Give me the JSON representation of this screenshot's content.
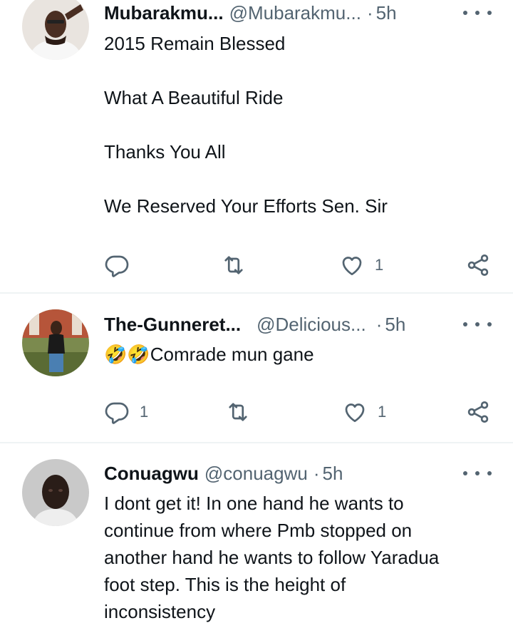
{
  "replies": [
    {
      "display_name": "Mubarakmu...",
      "handle": "@Mubarakmu...",
      "separator": "·",
      "time": "5h",
      "text_lines": [
        "2015 Remain Blessed",
        "What A Beautiful Ride",
        "Thanks You All",
        "We Reserved Your Efforts Sen. Sir"
      ],
      "reply_count": "",
      "retweet_count": "",
      "like_count": "1"
    },
    {
      "display_name": "The-Gunneret...",
      "handle": "@Delicious...",
      "separator": "·",
      "time": "5h",
      "emoji": "🤣🤣",
      "text": "Comrade mun gane",
      "reply_count": "1",
      "retweet_count": "",
      "like_count": "1"
    },
    {
      "display_name": "Conuagwu",
      "handle": "@conuagwu",
      "separator": "·",
      "time": "5h",
      "text_lines": [
        "I dont get it! In one hand  he wants to",
        "continue from where Pmb stopped on",
        "another hand he wants to follow  Yaradua",
        "foot step. This is the height of",
        "inconsistency"
      ]
    }
  ],
  "colors": {
    "text": "#0f1419",
    "secondary": "#536471",
    "divider": "#eff3f4"
  },
  "icons": [
    "reply-icon",
    "retweet-icon",
    "like-icon",
    "share-icon",
    "more-icon"
  ]
}
